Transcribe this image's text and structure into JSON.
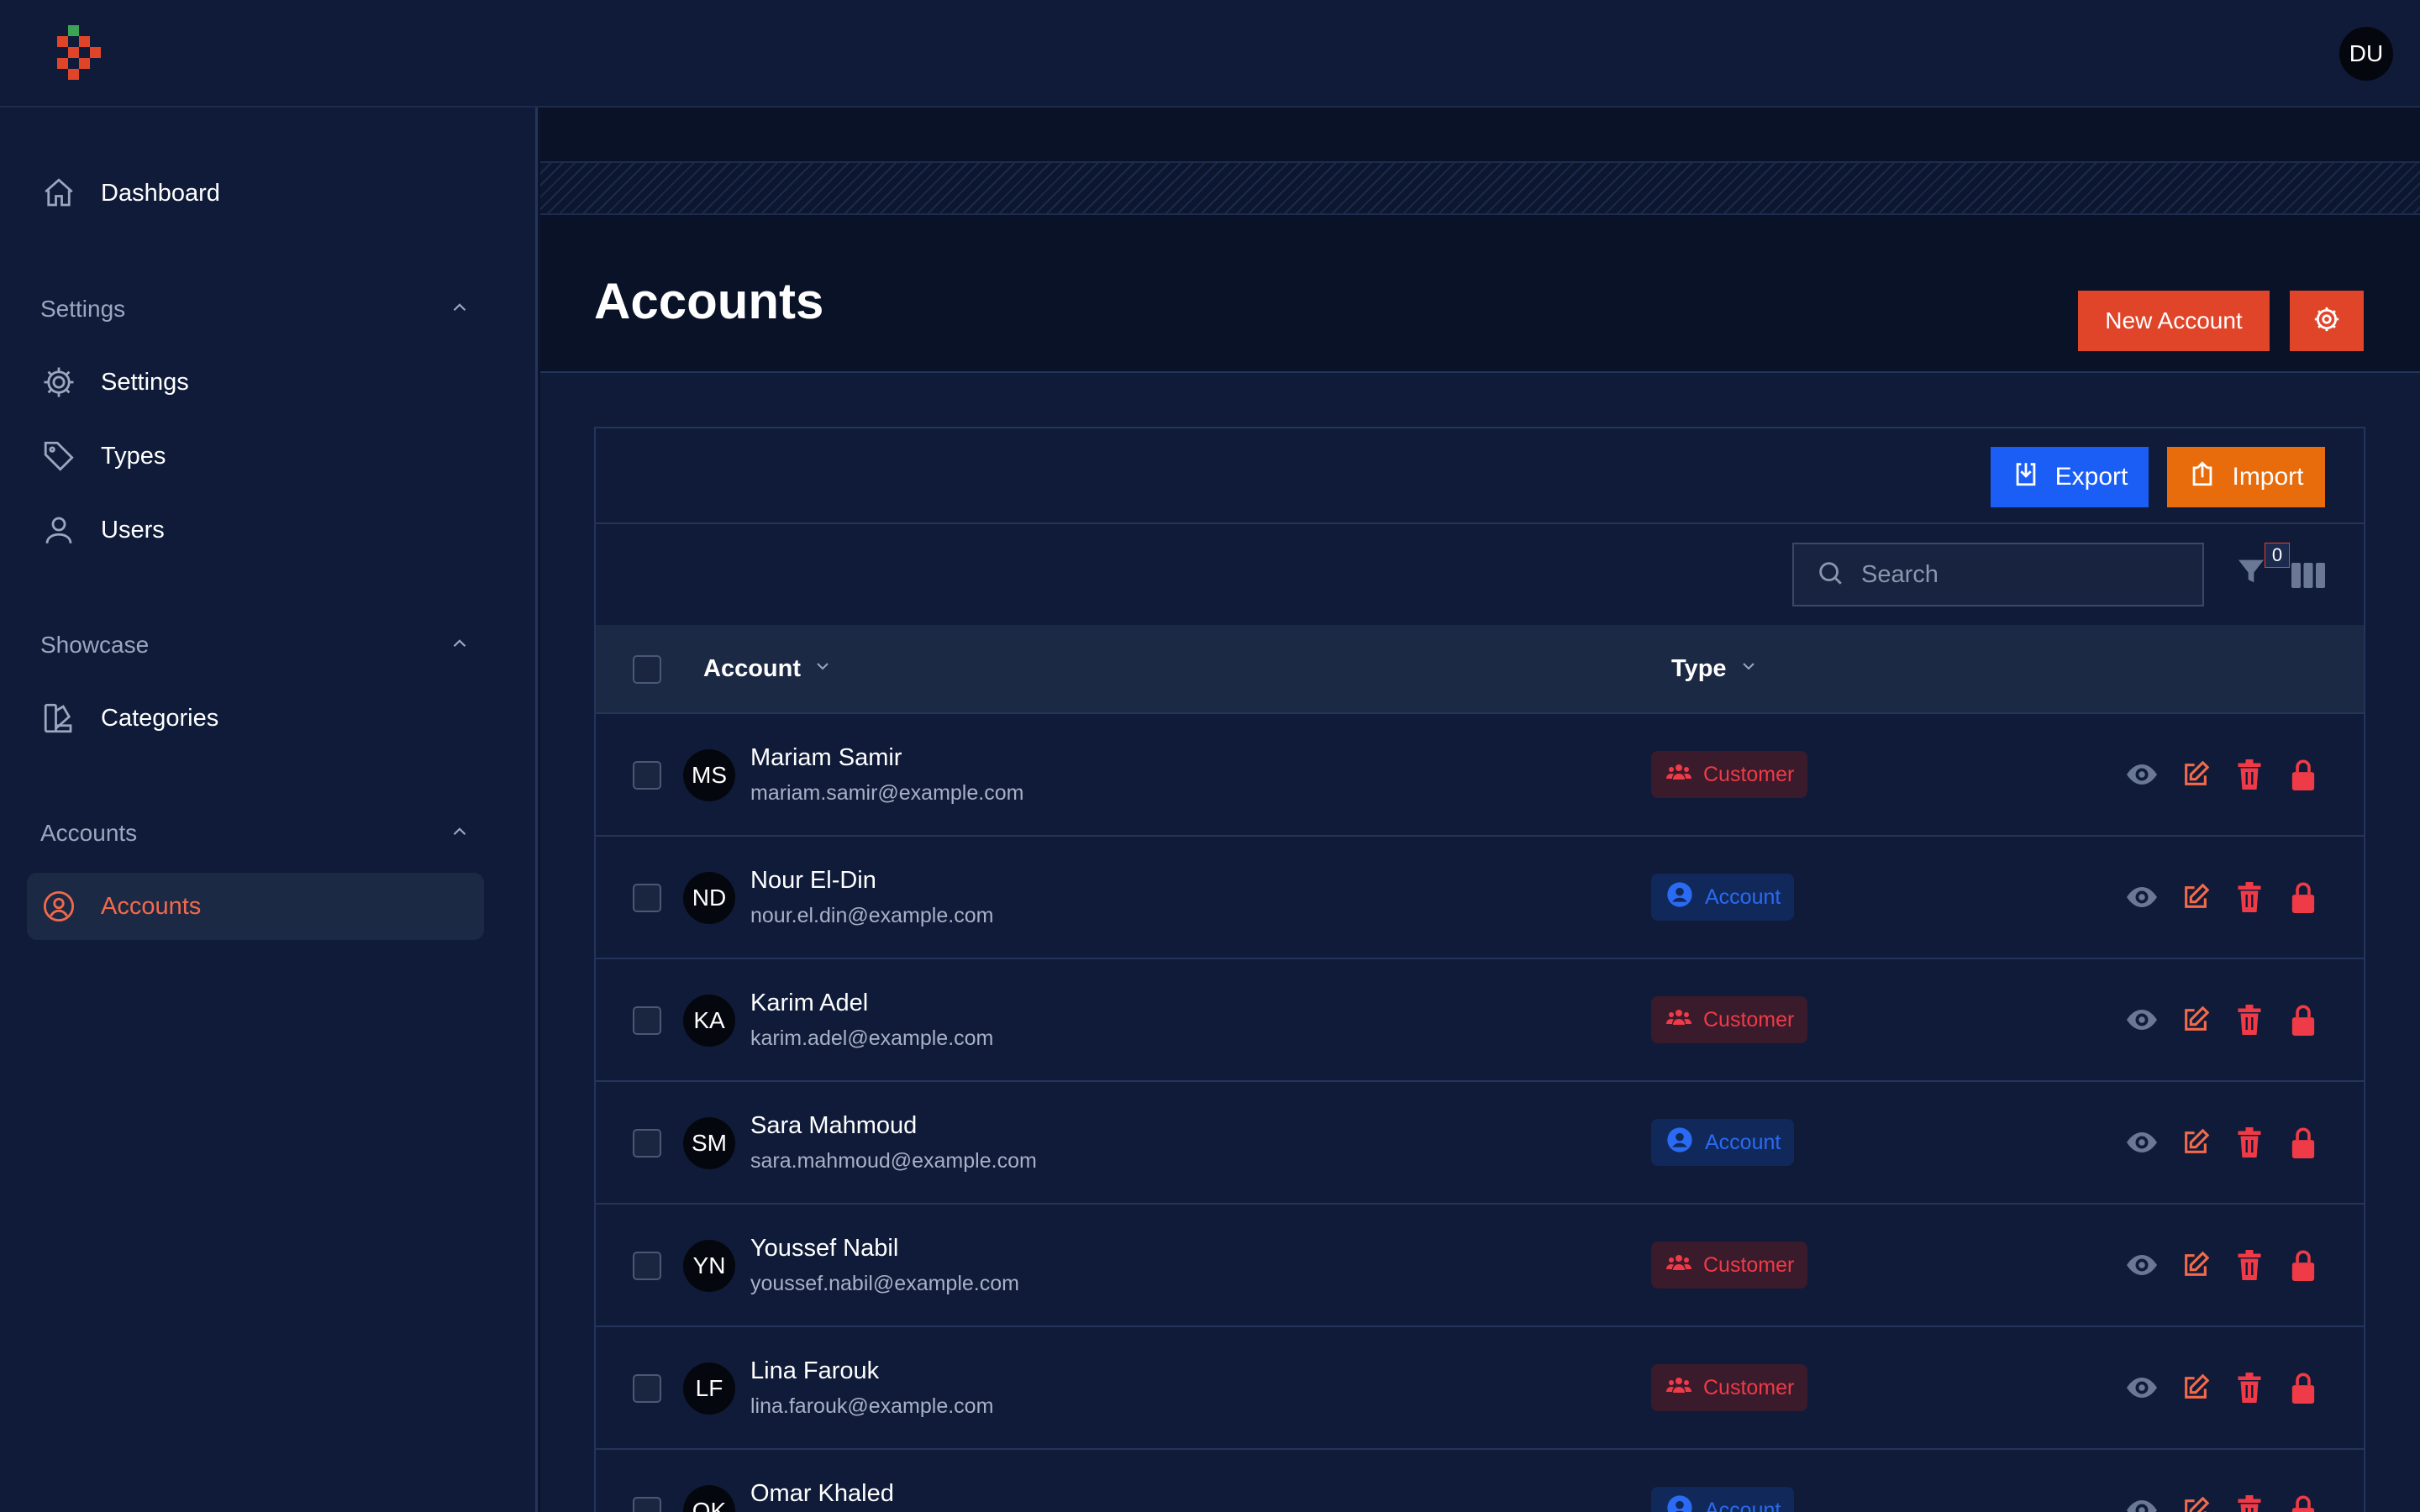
{
  "topbar": {
    "user_initials": "DU"
  },
  "sidebar": {
    "dashboard": "Dashboard",
    "groups": [
      {
        "label": "Settings",
        "items": [
          "Settings",
          "Types",
          "Users"
        ]
      },
      {
        "label": "Showcase",
        "items": [
          "Categories"
        ]
      },
      {
        "label": "Accounts",
        "items": [
          "Accounts"
        ]
      }
    ],
    "active": "Accounts"
  },
  "header": {
    "title": "Accounts",
    "new_button": "New Account"
  },
  "toolbar": {
    "export_label": "Export",
    "import_label": "Import",
    "search_placeholder": "Search",
    "filter_count": "0"
  },
  "table": {
    "columns": [
      "Account",
      "Type"
    ],
    "rows": [
      {
        "initials": "MS",
        "name": "Mariam Samir",
        "email": "mariam.samir@example.com",
        "type": "Customer"
      },
      {
        "initials": "ND",
        "name": "Nour El-Din",
        "email": "nour.el.din@example.com",
        "type": "Account"
      },
      {
        "initials": "KA",
        "name": "Karim Adel",
        "email": "karim.adel@example.com",
        "type": "Customer"
      },
      {
        "initials": "SM",
        "name": "Sara Mahmoud",
        "email": "sara.mahmoud@example.com",
        "type": "Account"
      },
      {
        "initials": "YN",
        "name": "Youssef Nabil",
        "email": "youssef.nabil@example.com",
        "type": "Customer"
      },
      {
        "initials": "LF",
        "name": "Lina Farouk",
        "email": "lina.farouk@example.com",
        "type": "Customer"
      },
      {
        "initials": "OK",
        "name": "Omar Khaled",
        "email": "",
        "type": "Account"
      }
    ]
  },
  "colors": {
    "brand": "#e0452a",
    "export": "#1a5ef5",
    "import": "#e96c0c",
    "customer": "#ef3a47",
    "account": "#2b6af2"
  }
}
